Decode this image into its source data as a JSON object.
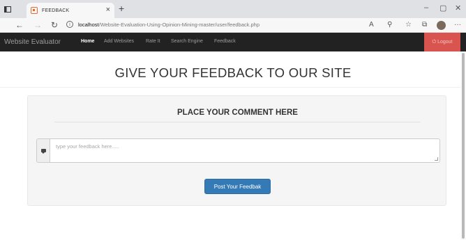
{
  "browser": {
    "tab_title": "FEEDBACK",
    "tab_close": "×",
    "new_tab": "+",
    "url_host": "localhost",
    "url_path": "/Website-Evaluation-Using-Opinion-Mining-master/user/feedback.php",
    "icons": [
      "back-icon",
      "forward-icon",
      "refresh-icon",
      "info-icon",
      "reading-mode-icon",
      "favorites-star-icon",
      "collections-icon",
      "profile-avatar",
      "more-icon"
    ]
  },
  "navbar": {
    "brand": "Website Evaluator",
    "items": [
      {
        "label": "Home",
        "active": true
      },
      {
        "label": "Add Websites",
        "active": false
      },
      {
        "label": "Rate It",
        "active": false
      },
      {
        "label": "Search Engine",
        "active": false
      },
      {
        "label": "Feedback",
        "active": false
      }
    ],
    "logout_label": "Logout",
    "logout_color": "#d9534f"
  },
  "page": {
    "heading": "GIVE YOUR FEEDBACK TO OUR SITE"
  },
  "form": {
    "title": "PLACE YOUR COMMENT HERE",
    "feedback_placeholder": "type your feedback here.....",
    "feedback_value": "",
    "submit_label": "Post Your Feedbak",
    "submit_color": "#337ab7"
  }
}
